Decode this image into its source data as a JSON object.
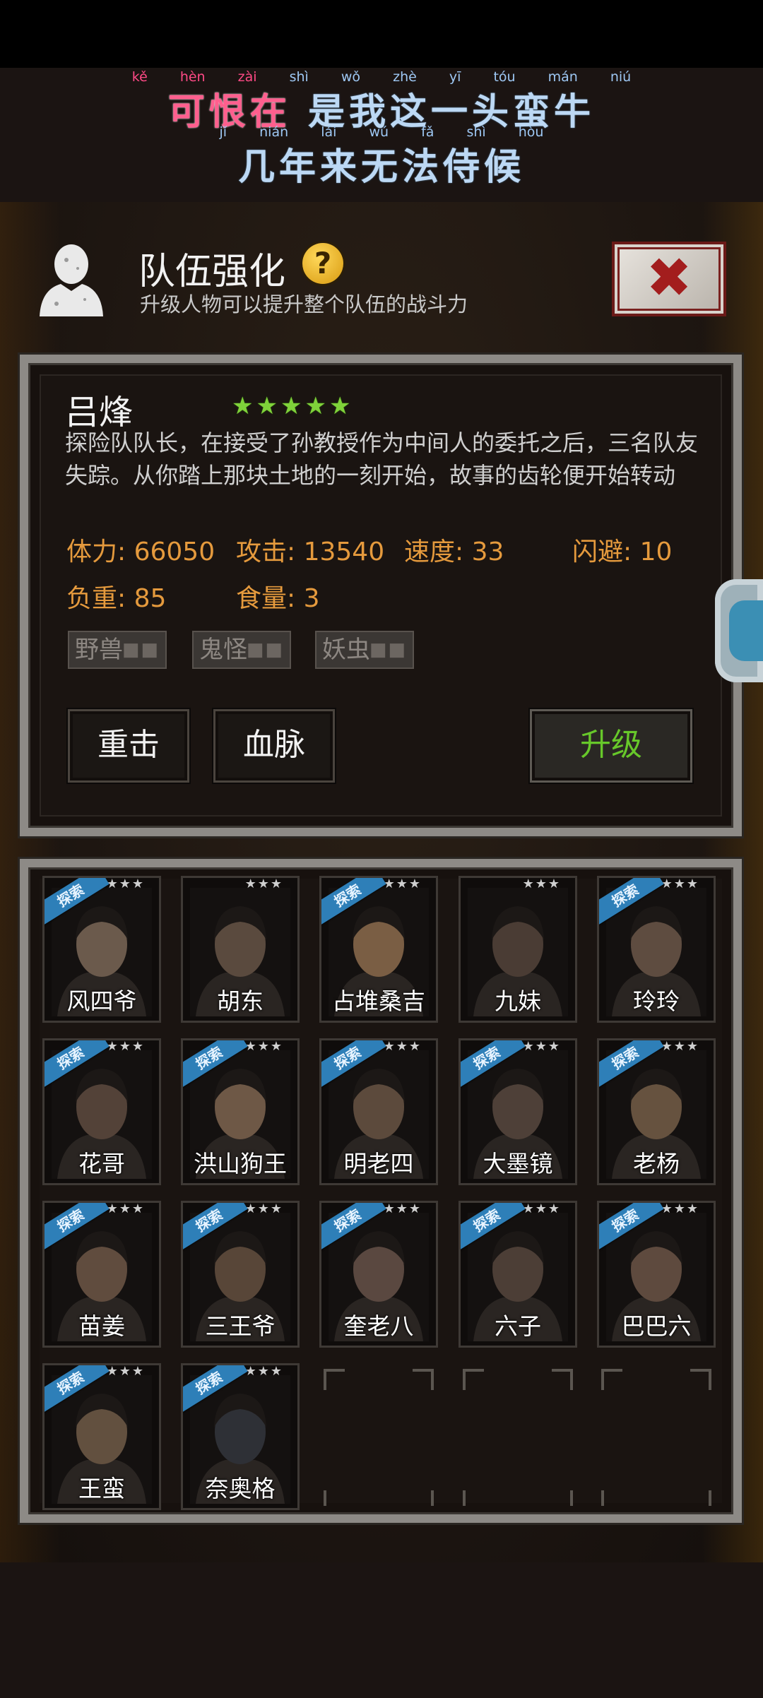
{
  "lyrics": {
    "line1": {
      "pinyin_pink": [
        "kě",
        "hèn",
        "zài"
      ],
      "pinyin_blue": [
        "shì",
        "wǒ",
        "zhè",
        "yī",
        "tóu",
        "mán",
        "niú"
      ],
      "hanzi_pink": "可恨在",
      "hanzi_blue": "是我这一头蛮牛"
    },
    "line2": {
      "pinyin": [
        "jǐ",
        "nián",
        "lái",
        "wú",
        "fǎ",
        "shì",
        "hòu"
      ],
      "hanzi": "几年来无法侍候"
    }
  },
  "panel": {
    "title": "队伍强化",
    "help_icon": "?",
    "subtitle": "升级人物可以提升整个队伍的战斗力",
    "close_icon": "✖"
  },
  "hero": {
    "name": "吕烽",
    "stars": 5,
    "description": "探险队队长，在接受了孙教授作为中间人的委托之后，三名队友失踪。从你踏上那块土地的一刻开始，故事的齿轮便开始转动",
    "stats": {
      "stamina": "体力: 66050",
      "attack": "攻击: 13540",
      "speed": "速度: 33",
      "dodge": "闪避: 10",
      "load": "负重: 85",
      "food": "食量: 3"
    },
    "tags": [
      "野兽",
      "鬼怪",
      "妖虫"
    ],
    "tag_dots": "■■",
    "buttons": {
      "heavy_strike": "重击",
      "bloodline": "血脉",
      "upgrade": "升级"
    }
  },
  "roster": {
    "ribbon_label": "探索",
    "star_glyphs": "★★★",
    "members": [
      {
        "name": "风四爷",
        "explore": true
      },
      {
        "name": "胡东",
        "explore": false
      },
      {
        "name": "占堆桑吉",
        "explore": true
      },
      {
        "name": "九妹",
        "explore": false
      },
      {
        "name": "玲玲",
        "explore": true
      },
      {
        "name": "花哥",
        "explore": true
      },
      {
        "name": "洪山狗王",
        "explore": true
      },
      {
        "name": "明老四",
        "explore": true
      },
      {
        "name": "大墨镜",
        "explore": true
      },
      {
        "name": "老杨",
        "explore": true
      },
      {
        "name": "苗姜",
        "explore": true
      },
      {
        "name": "三王爷",
        "explore": true
      },
      {
        "name": "奎老八",
        "explore": true
      },
      {
        "name": "六子",
        "explore": true
      },
      {
        "name": "巴巴六",
        "explore": true
      },
      {
        "name": "王蛮",
        "explore": true
      },
      {
        "name": "奈奥格",
        "explore": true
      }
    ],
    "empty_slots": 3
  },
  "colors": {
    "stat_text": "#e59a3d",
    "upgrade_text": "#67c82a",
    "hero_stars": "#7fd23a",
    "explore_ribbon": "#2e7fb8"
  }
}
